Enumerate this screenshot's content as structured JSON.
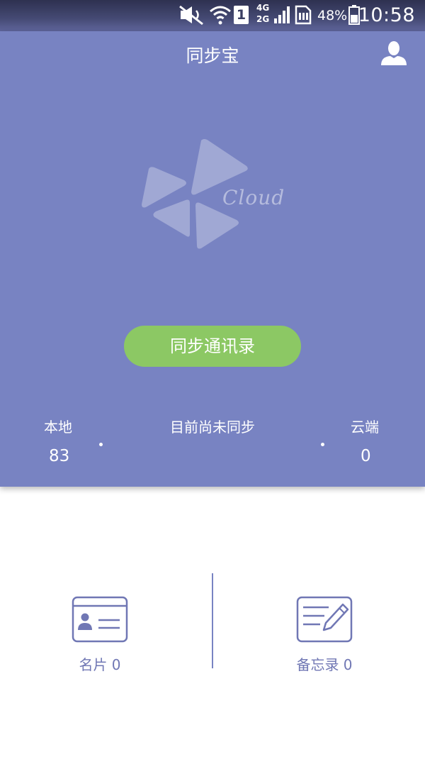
{
  "status_bar": {
    "sim_slot": "1",
    "network_top": "4G",
    "network_bottom": "2G",
    "battery_percent": "48%",
    "time": "10:58"
  },
  "header": {
    "title": "同步宝",
    "profile_icon": "person-icon"
  },
  "logo": {
    "wordmark": "Cloud"
  },
  "sync_button": {
    "label": "同步通讯录"
  },
  "stats": {
    "local_label": "本地",
    "local_count": "83",
    "status_text": "目前尚未同步",
    "cloud_label": "云端",
    "cloud_count": "0"
  },
  "features": [
    {
      "label": "名片 0",
      "icon": "business-card-icon"
    },
    {
      "label": "备忘录 0",
      "icon": "memo-edit-icon"
    }
  ],
  "colors": {
    "primary": "#7883c2",
    "button_green": "#8cc864",
    "text_white": "#ffffff",
    "icon_stroke": "#7077b4"
  }
}
